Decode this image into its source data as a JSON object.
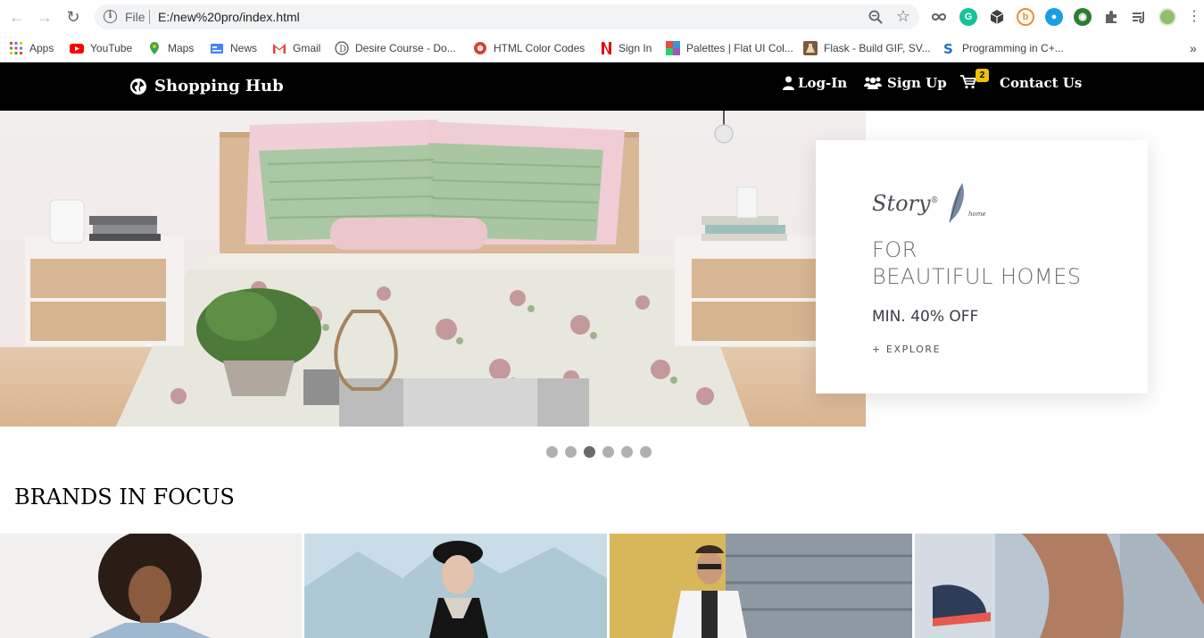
{
  "browser": {
    "address": {
      "scheme_label": "File",
      "url": "E:/new%20pro/index.html"
    },
    "bookmarks": [
      {
        "label": "Apps",
        "icon": "apps-grid-icon"
      },
      {
        "label": "YouTube",
        "icon": "youtube-icon"
      },
      {
        "label": "Maps",
        "icon": "maps-pin-icon"
      },
      {
        "label": "News",
        "icon": "news-icon"
      },
      {
        "label": "Gmail",
        "icon": "gmail-icon"
      },
      {
        "label": "Desire Course - Do...",
        "icon": "desire-course-icon"
      },
      {
        "label": "HTML Color Codes",
        "icon": "html-color-codes-icon"
      },
      {
        "label": "Sign In",
        "icon": "netflix-icon"
      },
      {
        "label": "Palettes | Flat UI Col...",
        "icon": "palettes-icon"
      },
      {
        "label": "Flask - Build GIF, SV...",
        "icon": "flask-icon"
      },
      {
        "label": "Programming in C+...",
        "icon": "programming-icon"
      }
    ]
  },
  "site": {
    "brand": "Shopping Hub",
    "nav": {
      "login": "Log-In",
      "signup": "Sign Up",
      "cart_count": "2",
      "contact": "Contact Us"
    },
    "hero": {
      "logo_text": "Story",
      "logo_reg": "®",
      "logo_sub": "home",
      "headline_line1": "FOR",
      "headline_line2": "BEAUTIFUL HOMES",
      "offer": "MIN. 40% OFF",
      "cta": "+ EXPLORE",
      "slide_count": 6,
      "active_slide": 3
    },
    "section_title": "BRANDS IN FOCUS",
    "brand_cards": [
      "brand-card-curly-hair-model",
      "brand-card-beret-model",
      "brand-card-jacket-model",
      "brand-card-running-shoes"
    ]
  },
  "colors": {
    "nav_bg": "#000000",
    "badge": "#f0c000",
    "dot_active": "#6a6a6a",
    "dot_inactive": "#b0b0b0"
  }
}
